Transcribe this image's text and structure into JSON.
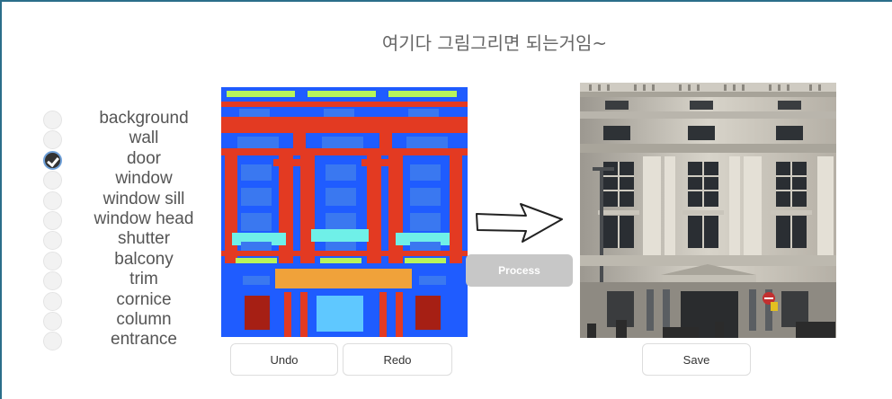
{
  "title": "여기다 그림그리면 되는거임~",
  "labels": [
    {
      "text": "background",
      "checked": false
    },
    {
      "text": "wall",
      "checked": false
    },
    {
      "text": "door",
      "checked": true
    },
    {
      "text": "window",
      "checked": false
    },
    {
      "text": "window sill",
      "checked": false
    },
    {
      "text": "window head",
      "checked": false
    },
    {
      "text": "shutter",
      "checked": false
    },
    {
      "text": "balcony",
      "checked": false
    },
    {
      "text": "trim",
      "checked": false
    },
    {
      "text": "cornice",
      "checked": false
    },
    {
      "text": "column",
      "checked": false
    },
    {
      "text": "entrance",
      "checked": false
    }
  ],
  "buttons": {
    "undo": "Undo",
    "redo": "Redo",
    "process": "Process",
    "save": "Save"
  },
  "colors": {
    "background": "#1a3fd8",
    "wall": "#1f5cff",
    "column": "#e33a22",
    "window": "#3a78f0",
    "sill": "#6ff0e8",
    "cornice_band": "#b7f55c",
    "trim": "#f0a23a",
    "door": "#a61f14",
    "entrance": "#5fc8ff"
  }
}
